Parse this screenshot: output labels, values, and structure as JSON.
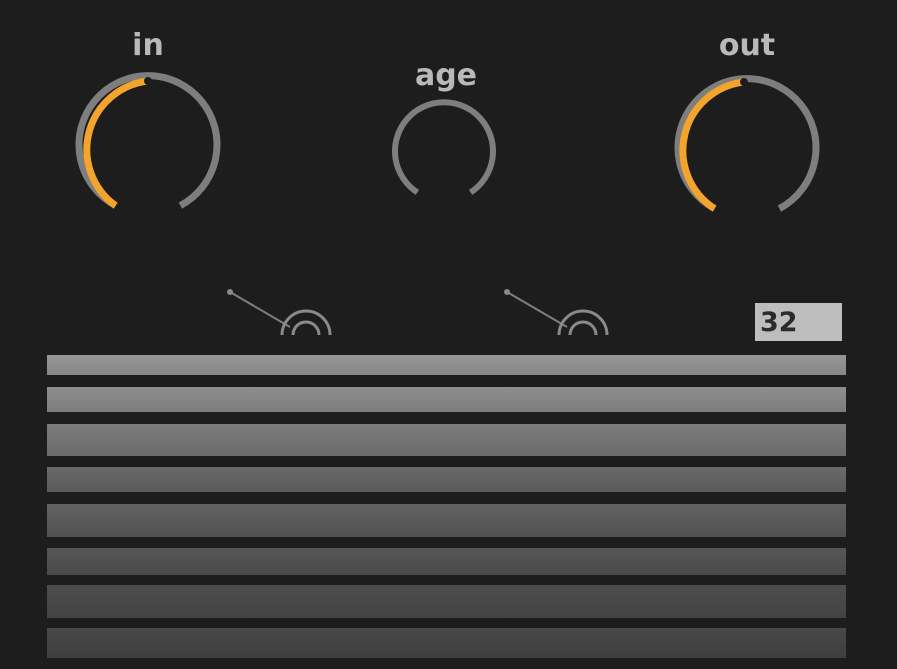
{
  "knobs": [
    {
      "id": "in",
      "label": "in",
      "value": 0.5,
      "active": true
    },
    {
      "id": "age",
      "label": "age",
      "value": 0.0,
      "active": false
    },
    {
      "id": "out",
      "label": "out",
      "value": 0.47,
      "active": true
    }
  ],
  "number_box": {
    "value": "32"
  },
  "colors": {
    "background": "#1d1d1d",
    "accent": "#f3a42c",
    "track": "#7e7e7e",
    "label": "#b9b9b9"
  },
  "bars": {
    "count": 8
  }
}
